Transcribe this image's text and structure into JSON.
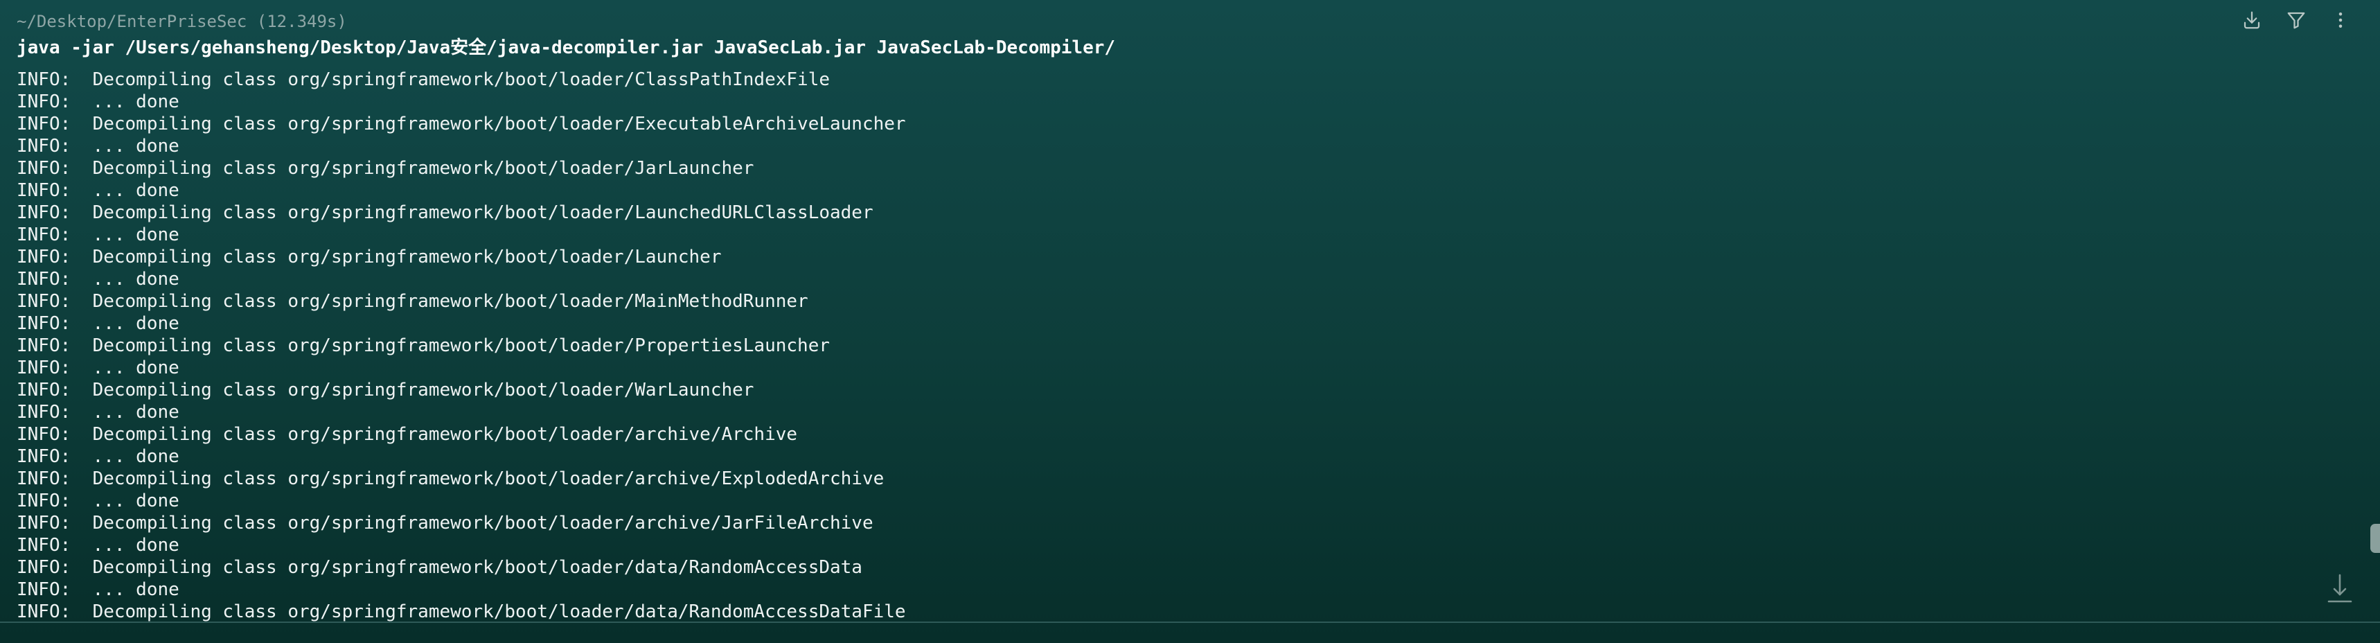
{
  "block": {
    "header": "~/Desktop/EnterPriseSec (12.349s)",
    "command": "java -jar /Users/gehansheng/Desktop/Java安全/java-decompiler.jar JavaSecLab.jar JavaSecLab-Decompiler/",
    "output_lines": [
      "INFO:  Decompiling class org/springframework/boot/loader/ClassPathIndexFile",
      "INFO:  ... done",
      "INFO:  Decompiling class org/springframework/boot/loader/ExecutableArchiveLauncher",
      "INFO:  ... done",
      "INFO:  Decompiling class org/springframework/boot/loader/JarLauncher",
      "INFO:  ... done",
      "INFO:  Decompiling class org/springframework/boot/loader/LaunchedURLClassLoader",
      "INFO:  ... done",
      "INFO:  Decompiling class org/springframework/boot/loader/Launcher",
      "INFO:  ... done",
      "INFO:  Decompiling class org/springframework/boot/loader/MainMethodRunner",
      "INFO:  ... done",
      "INFO:  Decompiling class org/springframework/boot/loader/PropertiesLauncher",
      "INFO:  ... done",
      "INFO:  Decompiling class org/springframework/boot/loader/WarLauncher",
      "INFO:  ... done",
      "INFO:  Decompiling class org/springframework/boot/loader/archive/Archive",
      "INFO:  ... done",
      "INFO:  Decompiling class org/springframework/boot/loader/archive/ExplodedArchive",
      "INFO:  ... done",
      "INFO:  Decompiling class org/springframework/boot/loader/archive/JarFileArchive",
      "INFO:  ... done",
      "INFO:  Decompiling class org/springframework/boot/loader/data/RandomAccessData",
      "INFO:  ... done",
      "INFO:  Decompiling class org/springframework/boot/loader/data/RandomAccessDataFile"
    ]
  },
  "toolbar": {
    "icons": [
      "download-icon",
      "filter-icon",
      "more-vertical-icon"
    ]
  },
  "icons": {
    "scroll_to_bottom": "arrow-down-to-line-icon"
  },
  "colors": {
    "background_top": "#124a4a",
    "background_bottom": "#072e2a",
    "header_text": "#8fa6a6",
    "command_text": "#ffffff",
    "output_text": "#eef3f3",
    "icon": "#b9c8c6"
  }
}
